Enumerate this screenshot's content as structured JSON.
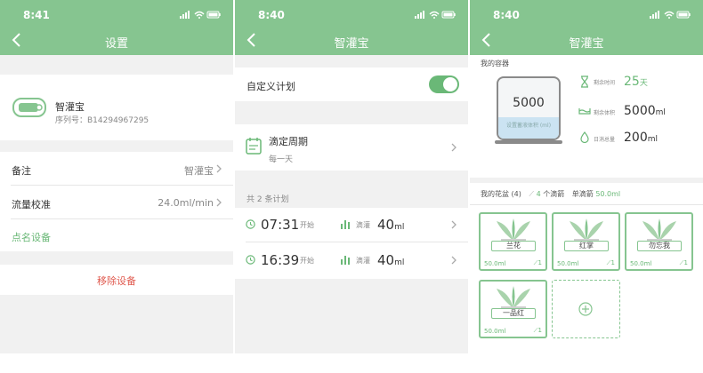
{
  "colors": {
    "primary": "#86c590",
    "accent_green": "#6ab877",
    "danger": "#e05a4f",
    "background": "#f1f1f1"
  },
  "settings": {
    "status_time": "8:41",
    "title": "设置",
    "device": {
      "name": "智灌宝",
      "serial": "序列号：B14294967295"
    },
    "rows": [
      {
        "label": "备注",
        "value": "智灌宝"
      },
      {
        "label": "流量校准",
        "value": "24.0ml/min"
      }
    ],
    "name_device_label": "点名设备",
    "remove_device_label": "移除设备"
  },
  "plan": {
    "status_time": "8:40",
    "title": "智灌宝",
    "custom_plan_label": "自定义计划",
    "custom_plan_enabled": true,
    "period": {
      "title": "滴定周期",
      "subtitle": "每一天"
    },
    "plan_count_label": "共 2 条计划",
    "items": [
      {
        "time": "07:31",
        "start_label": "开始",
        "action_label": "滴灌",
        "amount": "40",
        "unit": "ml"
      },
      {
        "time": "16:39",
        "start_label": "开始",
        "action_label": "滴灌",
        "amount": "40",
        "unit": "ml"
      }
    ]
  },
  "container": {
    "status_time": "8:40",
    "title": "智灌宝",
    "section_label": "我的容器",
    "tank_value": "5000",
    "tank_caption": "设置蓄液体积 (ml)",
    "fill_fraction": 0.35,
    "stats": [
      {
        "icon": "hourglass-icon",
        "label": "剩余时间",
        "value": "25",
        "unit": "天"
      },
      {
        "icon": "tray-icon",
        "label": "剩余体积",
        "value": "5000",
        "unit": "ml"
      },
      {
        "icon": "drop-icon",
        "label": "日消总量",
        "value": "200",
        "unit": "ml"
      }
    ],
    "pots_label": "我的花盆 (4)",
    "drippers_count": "4",
    "drippers_label": "个滴箭",
    "single_drip_label": "单滴箭",
    "single_drip_value": "50.0ml",
    "pots": [
      {
        "name": "兰花",
        "volume": "50.0ml",
        "count": "1"
      },
      {
        "name": "红掌",
        "volume": "50.0ml",
        "count": "1"
      },
      {
        "name": "勿忘我",
        "volume": "50.0ml",
        "count": "1"
      },
      {
        "name": "一品红",
        "volume": "50.0ml",
        "count": "1"
      }
    ]
  }
}
